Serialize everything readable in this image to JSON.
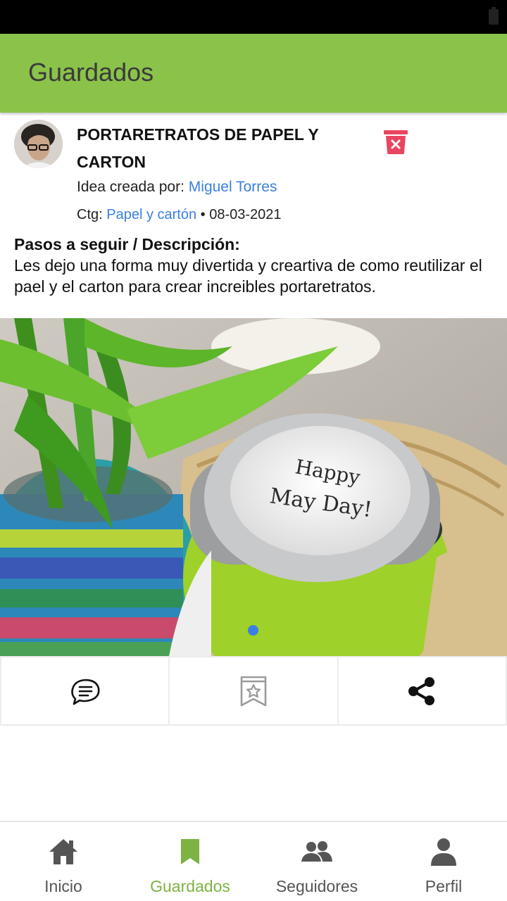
{
  "appbar": {
    "title": "Guardados"
  },
  "post": {
    "title": "PORTARETRATOS DE PAPEL Y CARTON",
    "creator_label": "Idea creada por: ",
    "creator_name": "Miguel Torres",
    "category_label": "Ctg: ",
    "category": "Papel y cartón",
    "date_sep": " • ",
    "date": "08-03-2021",
    "desc_heading": "Pasos a seguir / Descripción:",
    "description": " Les dejo una forma muy divertida y creartiva de como reutilizar el pael y el carton para crear increibles portaretratos.",
    "photo_lid_text_1": "Happy",
    "photo_lid_text_2": "May Day!",
    "carousel_current": 1
  },
  "nav": {
    "items": [
      {
        "label": "Inicio",
        "icon": "home-icon"
      },
      {
        "label": "Guardados",
        "icon": "bookmark-icon",
        "active": true
      },
      {
        "label": "Seguidores",
        "icon": "people-icon"
      },
      {
        "label": "Perfil",
        "icon": "person-icon"
      }
    ]
  },
  "colors": {
    "accent": "#8bc34a",
    "active_nav": "#7cb342",
    "link": "#3b7fe0",
    "delete": "#e94560"
  }
}
